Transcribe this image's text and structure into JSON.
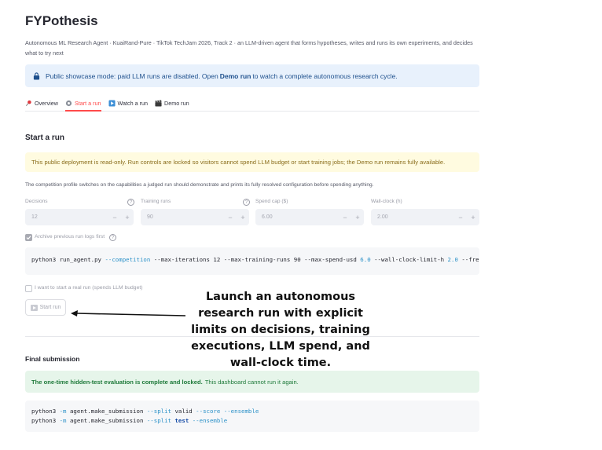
{
  "app": {
    "title": "FYPothesis",
    "subtitle": "Autonomous ML Research Agent · KuaiRand-Pure · TikTok TechJam 2026, Track 2 · an LLM-driven agent that forms hypotheses, writes and runs its own experiments, and decides what to try next"
  },
  "info_banner": {
    "icon": "lock-icon",
    "text_before": "Public showcase mode: paid LLM runs are disabled. Open ",
    "link": "Demo run",
    "text_after": " to watch a complete autonomous research cycle."
  },
  "tabs": [
    {
      "icon": "pushpin-icon",
      "label": "Overview"
    },
    {
      "icon": "gear-icon",
      "label": "Start a run"
    },
    {
      "icon": "play-icon",
      "label": "Watch a run"
    },
    {
      "icon": "clapper-icon",
      "label": "Demo run"
    }
  ],
  "start_run": {
    "heading": "Start a run",
    "warning": "This public deployment is read-only. Run controls are locked so visitors cannot spend LLM budget or start training jobs; the Demo run remains fully available.",
    "help": "The competition profile switches on the capabilities a judged run should demonstrate and prints its fully resolved configuration before spending anything.",
    "fields": [
      {
        "label": "Decisions",
        "value": "12",
        "has_help": true
      },
      {
        "label": "Training runs",
        "value": "90",
        "has_help": true
      },
      {
        "label": "Spend cap ($)",
        "value": "6.00",
        "has_help": false
      },
      {
        "label": "Wall-clock (h)",
        "value": "2.00",
        "has_help": false
      }
    ],
    "minus": "−",
    "plus": "+",
    "archive_label": "Archive previous run logs first",
    "archive_help": "?",
    "command": {
      "prefix": "python3 run_agent.py ",
      "flag1": "--competition",
      "mid1": " --max-iterations 12 --max-training-runs 90 --max-spend-usd ",
      "num1": "6.0",
      "mid2": " --wall-clock-limit-h ",
      "num2": "2.0",
      "tail": " --fre"
    },
    "confirm_label": "I want to start a real run (spends LLM budget)",
    "start_button": "Start run"
  },
  "annotation": {
    "text": "Launch an autonomous research run with explicit limits on decisions, training executions, LLM spend, and wall-clock time."
  },
  "final": {
    "heading": "Final submission",
    "success_bold": "The one-time hidden-test evaluation is complete and locked.",
    "success_rest": "This dashboard cannot run it again.",
    "line1": {
      "a": "python3 ",
      "flag": "-m",
      "b": " agent.make_submission ",
      "c": "--split",
      "d": " valid ",
      "e": "--score",
      "f": " ",
      "g": "--ensemble"
    },
    "line2": {
      "a": "python3 ",
      "flag": "-m",
      "b": " agent.make_submission ",
      "c": "--split",
      "d": " ",
      "test": "test",
      "f": " ",
      "g": "--ensemble"
    }
  }
}
